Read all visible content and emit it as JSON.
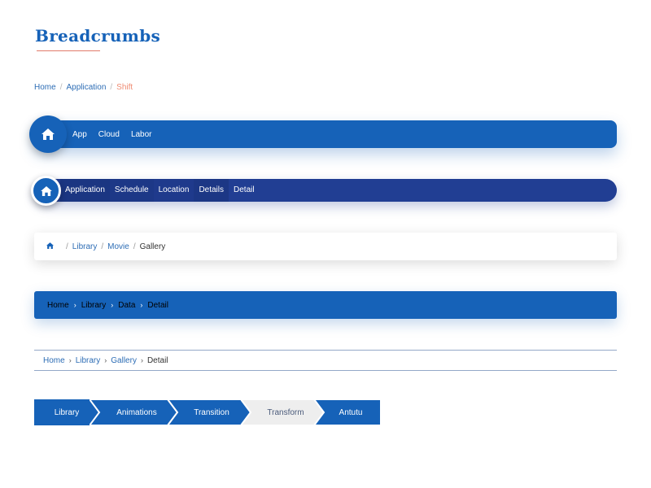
{
  "title": "Breadcrumbs",
  "bc_plain": {
    "items": [
      "Home",
      "Application"
    ],
    "active": "Shift",
    "separator": "/"
  },
  "bc_pill": {
    "home_icon": "home-icon",
    "items": [
      "App",
      "Cloud",
      "Labor"
    ]
  },
  "bc_navy": {
    "home_icon": "home-icon",
    "items": [
      "Application",
      "Schedule",
      "Location",
      "Details",
      "Detail"
    ]
  },
  "bc_card": {
    "home_icon": "home-icon",
    "items": [
      "Library",
      "Movie"
    ],
    "active": "Gallery",
    "separator": "/"
  },
  "bc_bar": {
    "items": [
      "Home",
      "Library",
      "Data",
      "Detail"
    ],
    "separator": "›"
  },
  "bc_lines": {
    "items": [
      "Home",
      "Library",
      "Gallery"
    ],
    "active": "Detail",
    "separator": "›"
  },
  "bc_steps": {
    "items": [
      "Library",
      "Animations",
      "Transition",
      "Transform",
      "Antutu"
    ],
    "active_index": 3
  },
  "colors": {
    "primary": "#1662b8",
    "navy": "#213e93",
    "accent": "#ef8c73",
    "step_inactive": "#eeeeee"
  }
}
